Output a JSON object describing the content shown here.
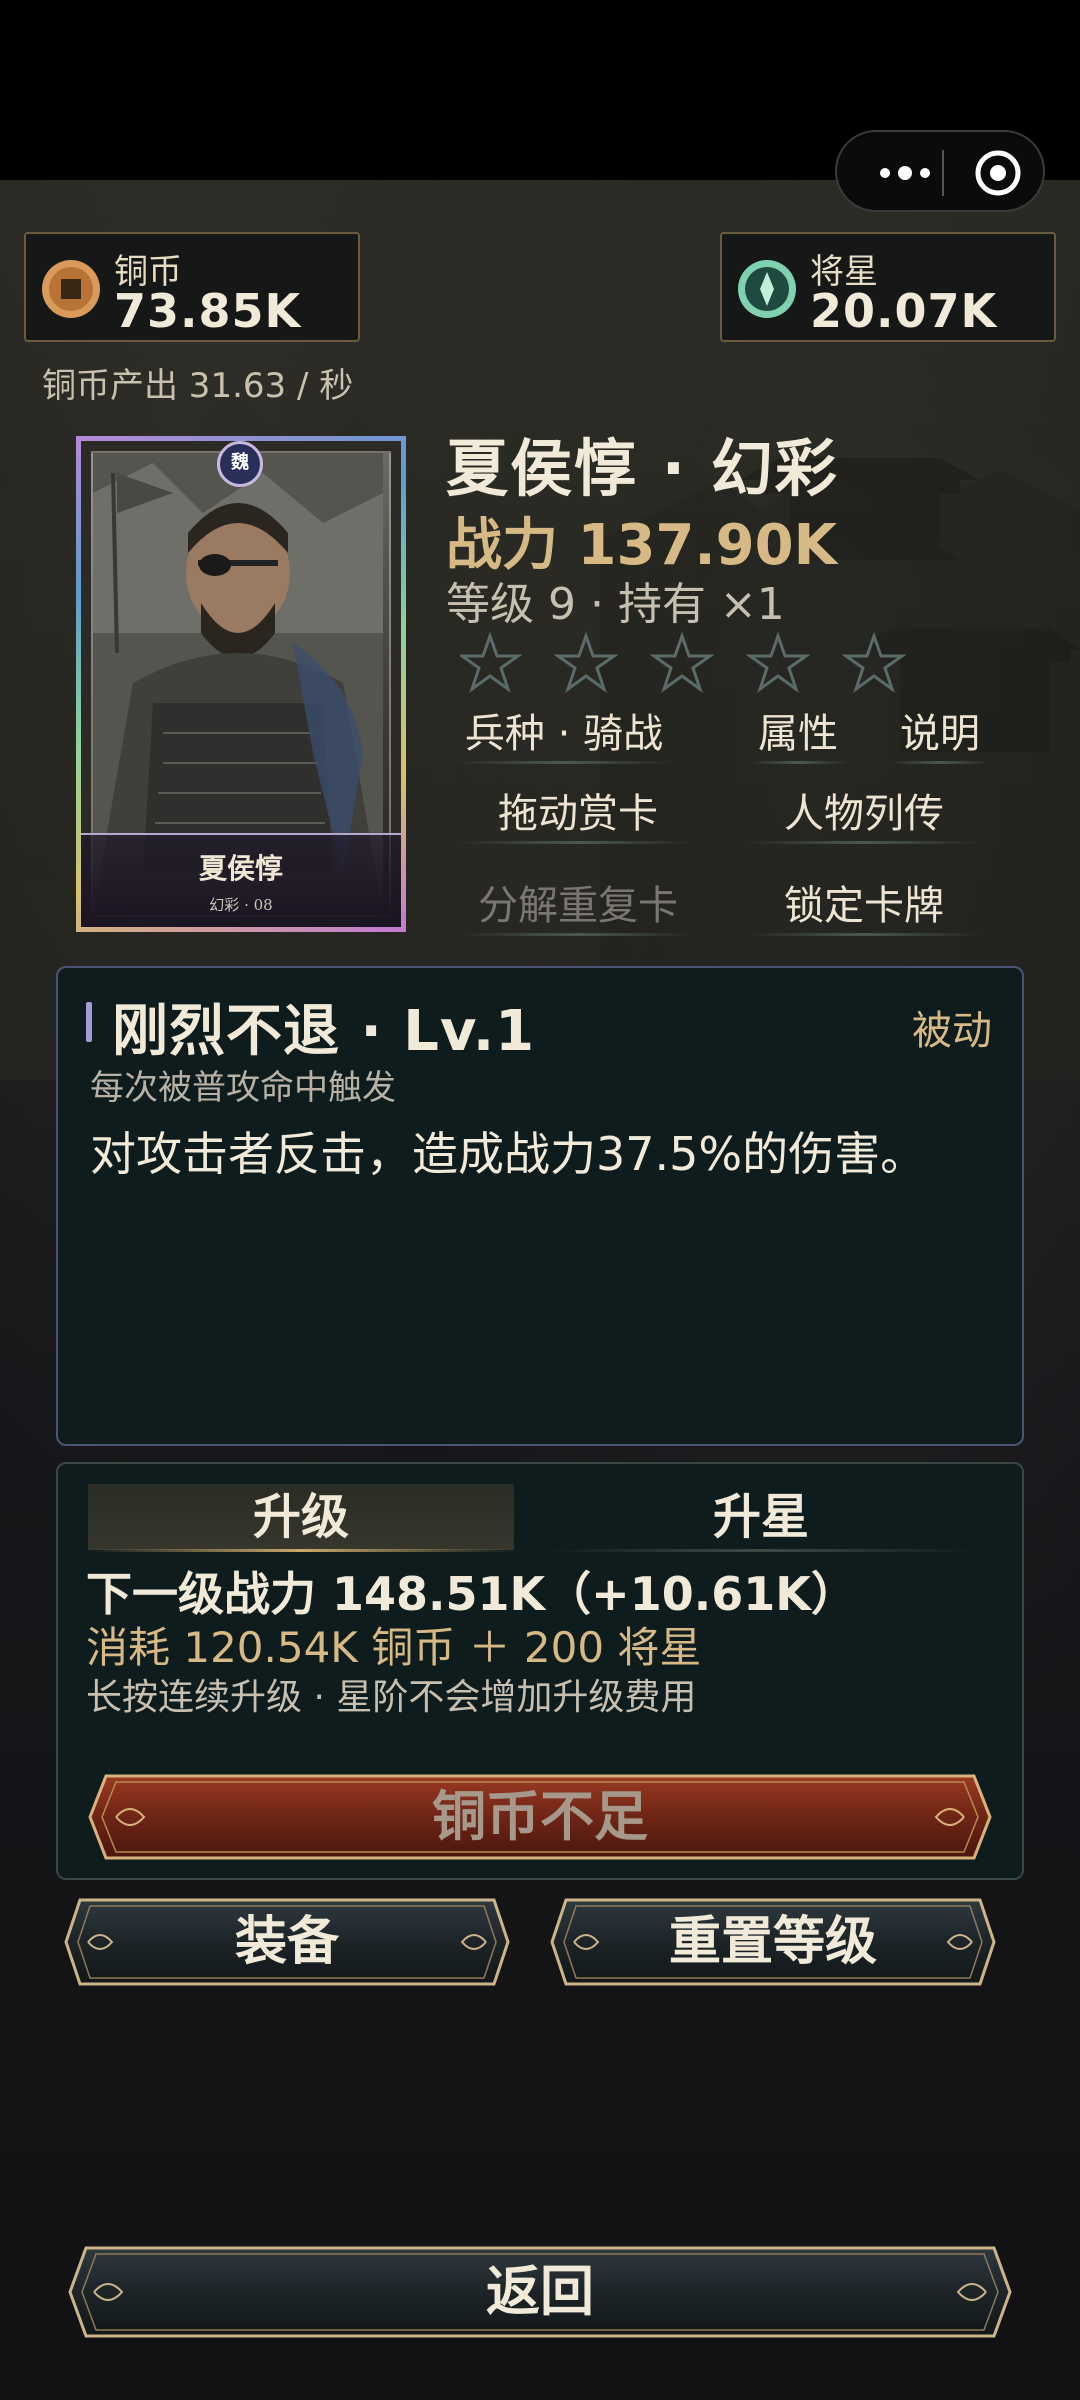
{
  "capsule": {
    "more_icon": "more-dots-icon",
    "close_icon": "target-circle-icon"
  },
  "currencies": {
    "coin": {
      "label": "铜币",
      "value": "73.85K",
      "icon": "copper-coin-icon",
      "color": "#d99a5a"
    },
    "star": {
      "label": "将星",
      "value": "20.07K",
      "icon": "general-star-icon",
      "color": "#7fd1b0"
    },
    "rate_text": "铜币产出 31.63 / 秒"
  },
  "card": {
    "kingdom": "魏",
    "name": "夏侯惇",
    "sub": "幻彩 · 08"
  },
  "hero": {
    "title": "夏侯惇 · 幻彩",
    "power": "战力 137.90K",
    "level": "等级 9 · 持有 ×1",
    "stars_filled": 0,
    "stars_total": 5
  },
  "menu": {
    "troop": "兵种 · 骑战",
    "attributes": "属性",
    "explain": "说明",
    "drag_card": "拖动赏卡",
    "biography": "人物列传",
    "decompose": "分解重复卡",
    "lock": "锁定卡牌"
  },
  "skill": {
    "name": "刚烈不退 · Lv.1",
    "type": "被动",
    "trigger": "每次被普攻命中触发",
    "desc": "对攻击者反击，造成战力37.5%的伤害。"
  },
  "upgrade": {
    "tab_level": "升级",
    "tab_star": "升星",
    "next": "下一级战力 148.51K（+10.61K）",
    "cost": "消耗 120.54K 铜币 ＋ 200 将星",
    "hint": "长按连续升级 · 星阶不会增加升级费用",
    "action": "铜币不足"
  },
  "buttons": {
    "equip": "装备",
    "reset": "重置等级",
    "back": "返回"
  },
  "colors": {
    "gold": "#d6b985",
    "panel": "#0f1c1e",
    "accent_purple": "#a69ad8",
    "danger_btn": "#7a2a1c"
  }
}
